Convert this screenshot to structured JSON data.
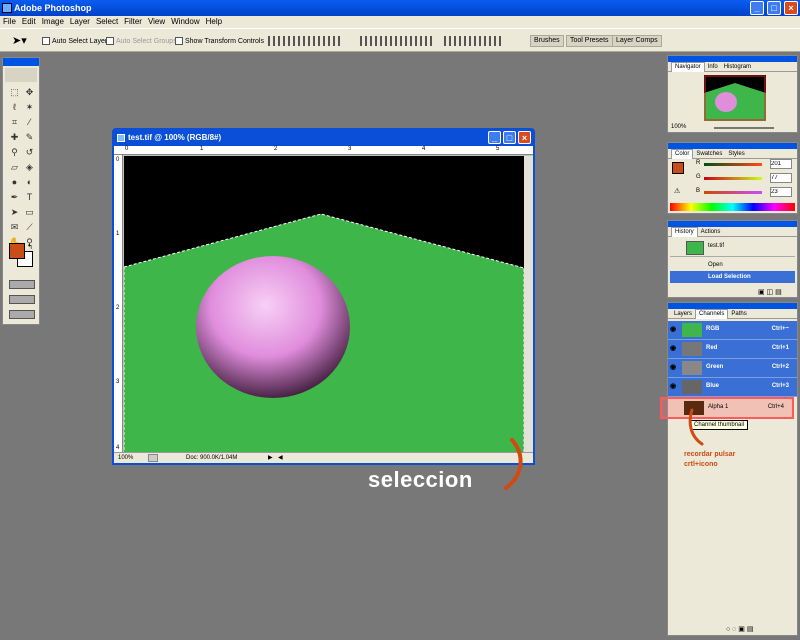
{
  "app": {
    "title": "Adobe Photoshop"
  },
  "menu": [
    "File",
    "Edit",
    "Image",
    "Layer",
    "Select",
    "Filter",
    "View",
    "Window",
    "Help"
  ],
  "options": {
    "auto_select_layer": "Auto Select Layer",
    "auto_select_groups": "Auto Select Groups",
    "show_transform": "Show Transform Controls"
  },
  "dock": {
    "brushes": "Brushes",
    "tool_presets": "Tool Presets",
    "layer_comps": "Layer Comps"
  },
  "document": {
    "title": "test.tif @ 100% (RGB/8#)",
    "zoom": "100%",
    "doc_info": "Doc: 900.0K/1.04M",
    "ruler_top": [
      "0",
      "1",
      "2",
      "3",
      "4",
      "5"
    ],
    "ruler_left": [
      "0",
      "1",
      "2",
      "3",
      "4"
    ]
  },
  "navigator": {
    "tabs": [
      "Navigator",
      "Info",
      "Histogram"
    ],
    "zoom": "100%"
  },
  "color": {
    "tabs": [
      "Color",
      "Swatches",
      "Styles"
    ],
    "r_label": "R",
    "g_label": "G",
    "b_label": "B",
    "r": "201",
    "g": "77",
    "b": "23",
    "swatch": "#c94d17"
  },
  "history": {
    "tabs": [
      "History",
      "Actions"
    ],
    "snapshot": "test.tif",
    "items": [
      "Open",
      "Load Selection"
    ]
  },
  "channels": {
    "tabs": [
      "Layers",
      "Channels",
      "Paths"
    ],
    "rows": [
      {
        "name": "RGB",
        "shortcut": "Ctrl+~"
      },
      {
        "name": "Red",
        "shortcut": "Ctrl+1"
      },
      {
        "name": "Green",
        "shortcut": "Ctrl+2"
      },
      {
        "name": "Blue",
        "shortcut": "Ctrl+3"
      },
      {
        "name": "Alpha 1",
        "shortcut": "Ctrl+4"
      }
    ],
    "tooltip": "Channel thumbnail"
  },
  "annotations": {
    "main": "seleccion",
    "note_line1": "recordar pulsar",
    "note_line2": "crtl+icono"
  },
  "colors": {
    "accent": "#0054e3",
    "foreground": "#c94d17",
    "selection_green": "#3fb64a",
    "sphere": "#e38ee0",
    "annotation": "#d04a12"
  }
}
